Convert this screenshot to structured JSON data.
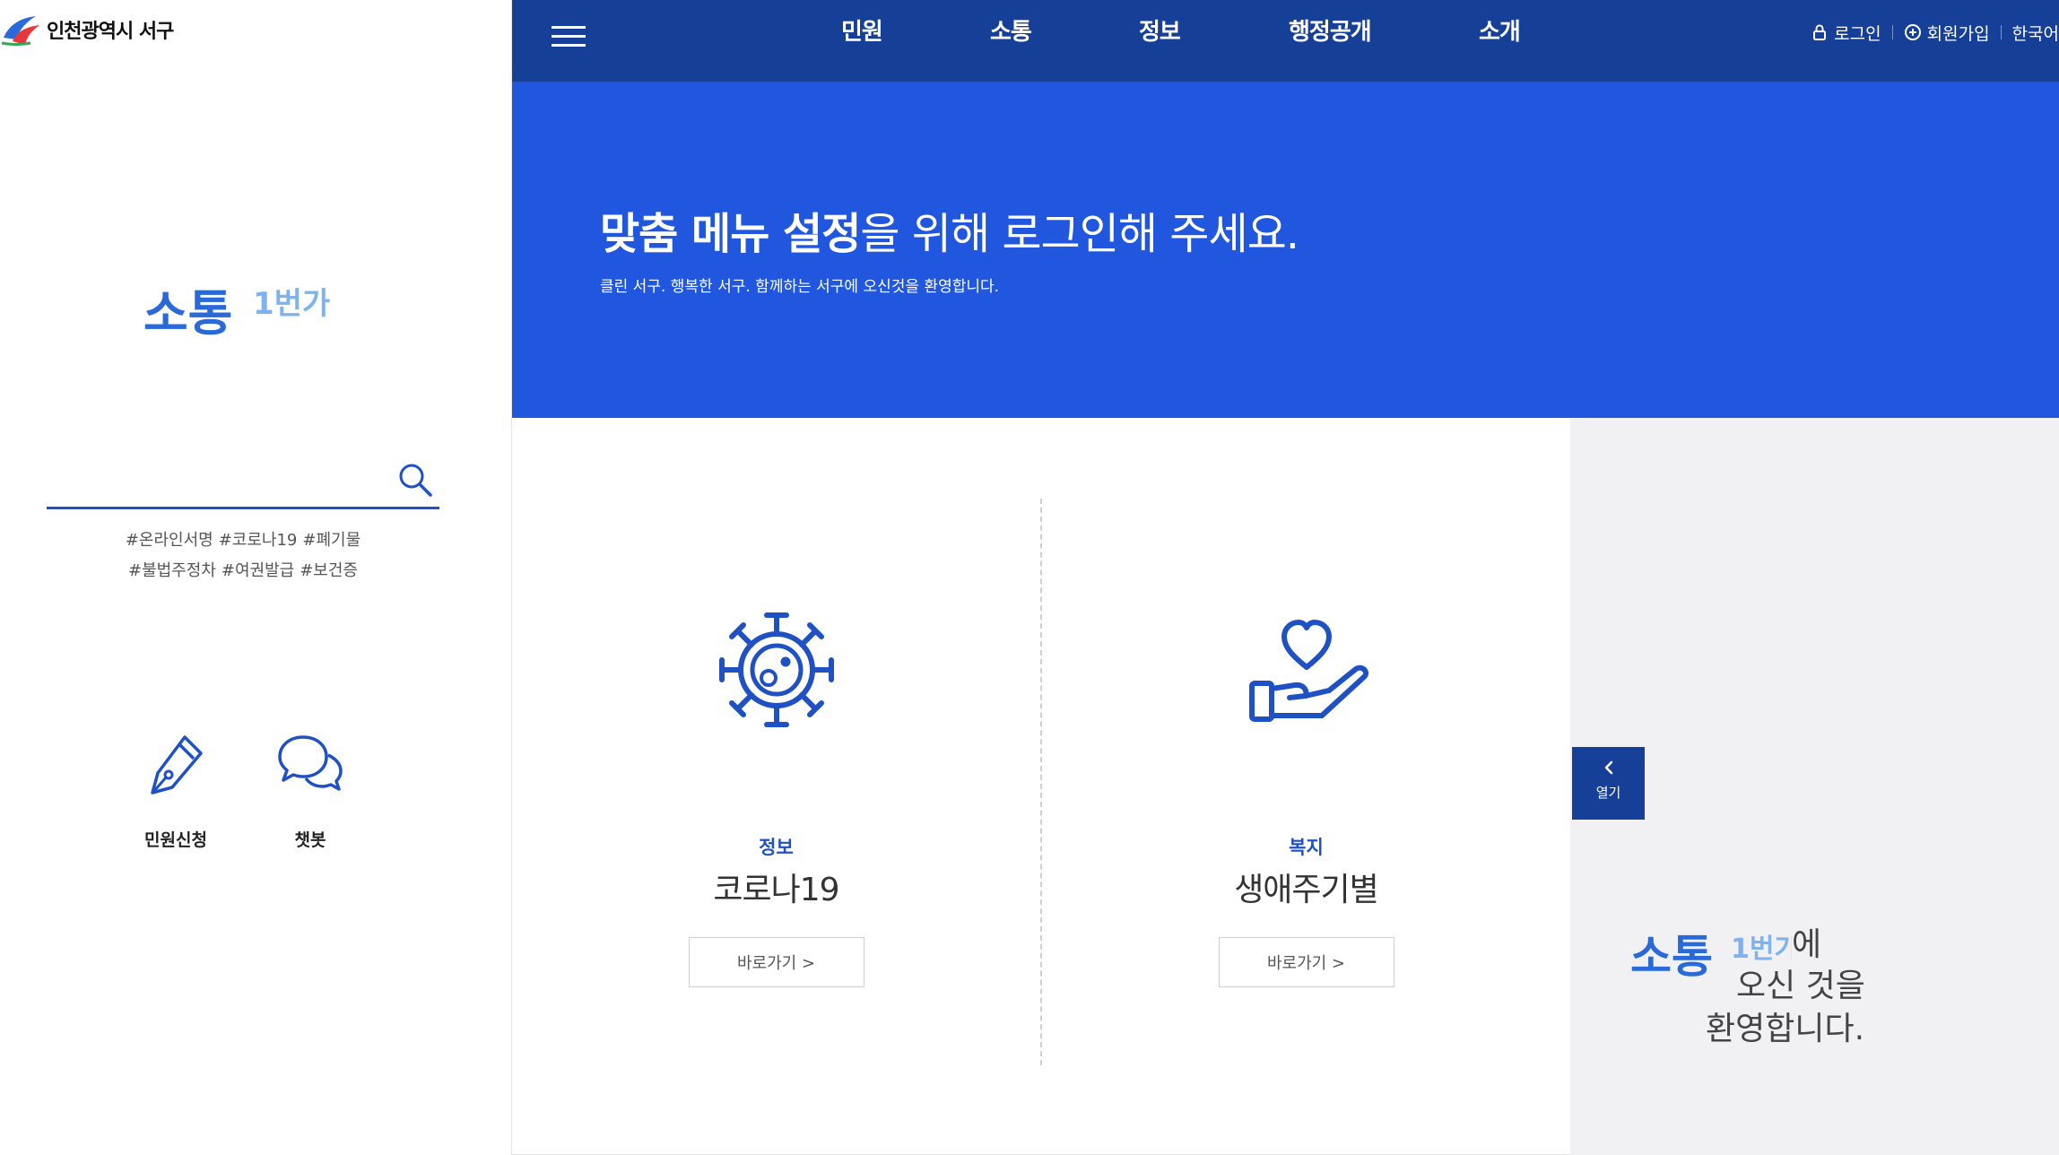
{
  "header": {
    "logo_text": "인천광역시 서구",
    "nav": [
      "민원",
      "소통",
      "정보",
      "행정공개",
      "소개"
    ],
    "login": "로그인",
    "signup": "회원가입",
    "language": "한국어"
  },
  "sidebar": {
    "brand_main": "소통",
    "brand_sub": "1번가",
    "search": {
      "placeholder": "",
      "value": ""
    },
    "hashtags": [
      [
        "#온라인서명",
        "#코로나19",
        "#폐기물"
      ],
      [
        "#불법주정차",
        "#여권발급",
        "#보건증"
      ]
    ],
    "quick_links": [
      {
        "label": "민원신청",
        "icon": "pen-icon"
      },
      {
        "label": "챗봇",
        "icon": "chat-icon"
      }
    ]
  },
  "hero": {
    "title_bold": "맞춤 메뉴 설정",
    "title_rest": "을 위해 로그인해 주세요.",
    "subtitle": "클린 서구. 행복한 서구. 함께하는 서구에 오신것을 환영합니다."
  },
  "cards": [
    {
      "category": "정보",
      "title": "코로나19",
      "button": "바로가기 >",
      "icon": "virus-icon"
    },
    {
      "category": "복지",
      "title": "생애주기별",
      "button": "바로가기 >",
      "icon": "heart-hand-icon"
    }
  ],
  "right_panel": {
    "open_label": "열기",
    "welcome_brand": "소통1번가",
    "welcome_line1": "에",
    "welcome_line2": "오신 것을",
    "welcome_line3": "환영합니다."
  },
  "colors": {
    "nav_bg": "#163f98",
    "hero_bg": "#2157df",
    "accent": "#1f51c4",
    "panel_bg": "#f1f1f4"
  }
}
